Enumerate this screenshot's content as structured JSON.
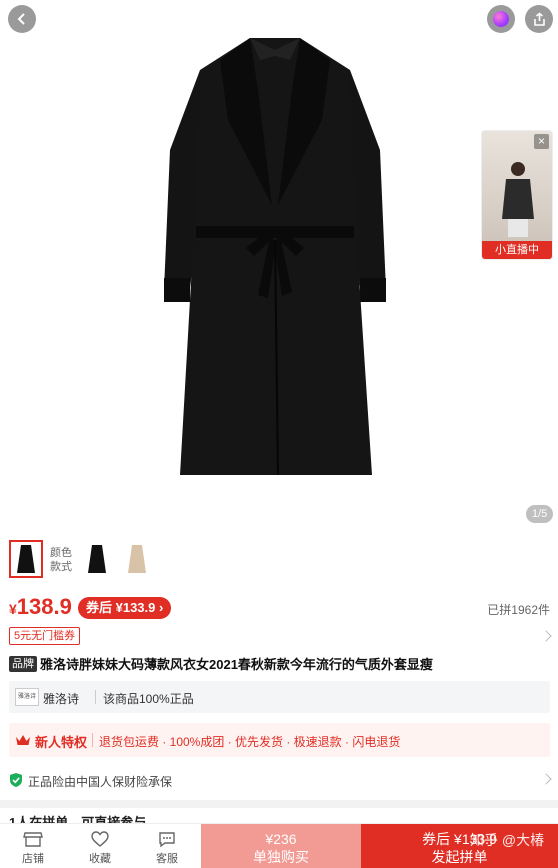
{
  "header": {
    "back_icon": "chevron-left-icon",
    "mall_icon": "colorful-orb-icon",
    "share_icon": "share-icon"
  },
  "live": {
    "label": "小直播中",
    "close": "×"
  },
  "gallery": {
    "counter": "1/5"
  },
  "sku": {
    "label_color": "颜色",
    "label_style": "款式"
  },
  "price": {
    "currency": "¥",
    "value": "138.9",
    "coupon_label": "券后 ¥133.9 ›",
    "sold": "已拼1962件"
  },
  "tag": {
    "text": "5元无门槛券"
  },
  "product": {
    "brand_tag": "品牌",
    "title": "雅洛诗胖妹妹大码薄款风衣女2021春秋新款今年流行的气质外套显瘦"
  },
  "brand": {
    "logo_text": "雅洛诗",
    "name": "雅洛诗",
    "auth": "该商品100%正品"
  },
  "new_user": {
    "title": "新人特权",
    "items": "退货包运费 · 100%成团 · 优先发货 · 极速退款 · 闪电退货"
  },
  "insurance": {
    "text": "正品险由中国人保财险承保"
  },
  "group": {
    "text": "1人在拼单，可直接参与"
  },
  "bottom": {
    "shop": "店铺",
    "favorite": "收藏",
    "service": "客服",
    "single_price": "¥236",
    "single_label": "单独购买",
    "group_price": "券后 ¥133.9",
    "group_label": "发起拼单"
  },
  "watermark": "知乎 @大椿",
  "colors": {
    "accent": "#e02e24",
    "accent_light": "#f29a94"
  }
}
